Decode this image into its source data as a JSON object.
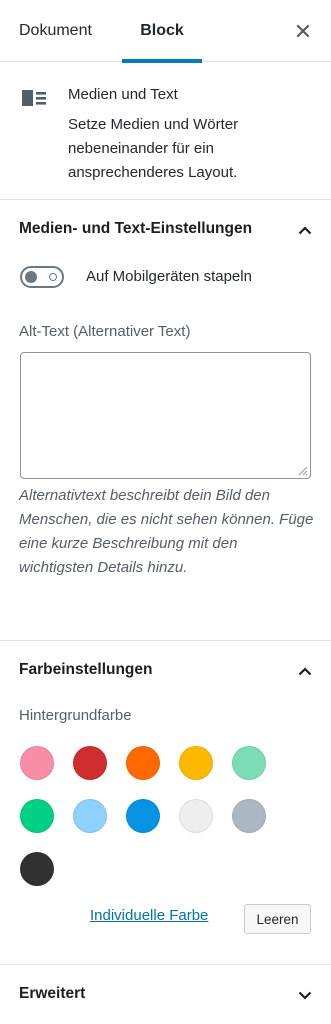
{
  "tabs": {
    "document_label": "Dokument",
    "block_label": "Block",
    "active": "Block"
  },
  "block": {
    "title": "Medien und Text",
    "description": "Setze Medien und Wörter nebeneinander für ein ansprechenderes Layout."
  },
  "media_text_settings": {
    "title": "Medien- und Text-Einstellungen",
    "expanded": true,
    "toggle_label": "Auf Mobilgeräten stapeln",
    "toggle_on": false,
    "alt_label": "Alt-Text (Alternativer Text)",
    "alt_value": "",
    "help_text": "Alternativtext beschreibt dein Bild den Menschen, die es nicht sehen können. Füge eine kurze Beschreibung mit den wichtigsten Details hinzu."
  },
  "color_settings": {
    "title": "Farbeinstellungen",
    "expanded": true,
    "background_label": "Hintergrundfarbe",
    "swatches": [
      "#f78da7",
      "#cf2e2e",
      "#ff6900",
      "#fcb900",
      "#7bdcb5",
      "#00d084",
      "#8ed1fc",
      "#0693e3",
      "#eeeeee",
      "#abb8c3",
      "#313131"
    ],
    "custom_color_label": "Individuelle Farbe",
    "clear_label": "Leeren"
  },
  "advanced": {
    "title": "Erweitert",
    "expanded": false
  },
  "accent_color": "#007cba",
  "icons": {
    "close": "close-icon",
    "block": "media-text-icon",
    "collapse": "chevron-up-icon",
    "expand": "chevron-down-icon"
  }
}
